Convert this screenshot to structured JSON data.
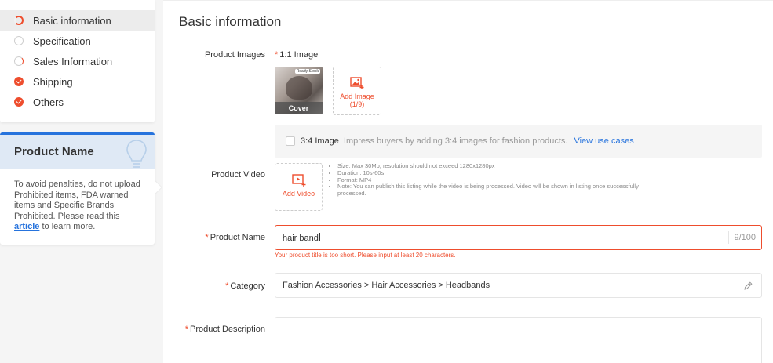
{
  "nav": {
    "items": [
      {
        "label": "Basic information",
        "status": "ring"
      },
      {
        "label": "Specification",
        "status": "empty"
      },
      {
        "label": "Sales Information",
        "status": "half"
      },
      {
        "label": "Shipping",
        "status": "check"
      },
      {
        "label": "Others",
        "status": "check"
      }
    ]
  },
  "tip": {
    "title": "Product Name",
    "text_before": "To avoid penalties, do not upload Prohibited items, FDA warned items and Specific Brands Prohibited. Please read this ",
    "link": "article",
    "text_after": " to learn more."
  },
  "main": {
    "section_title": "Basic information",
    "product_images": {
      "label": "Product Images",
      "ratio_label": "1:1 Image",
      "cover_badge": "Ready Stock",
      "cover_label": "Cover",
      "add_label": "Add Image",
      "add_count": "(1/9)"
    },
    "ratio34": {
      "label": "3:4 Image",
      "hint": "Impress buyers by adding 3:4 images for fashion products.",
      "link": "View use cases"
    },
    "product_video": {
      "label": "Product Video",
      "add_label": "Add Video",
      "notes": [
        "Size: Max 30Mb, resolution should not exceed 1280x1280px",
        "Duration: 10s-60s",
        "Format: MP4",
        "Note: You can publish this listing while the video is being processed. Video will be shown in listing once successfully processed."
      ]
    },
    "product_name": {
      "label": "Product Name",
      "value": "hair band",
      "count": "9/100",
      "error": "Your product title is too short. Please input at least 20 characters."
    },
    "category": {
      "label": "Category",
      "value": "Fashion Accessories > Hair Accessories > Headbands"
    },
    "product_description": {
      "label": "Product Description"
    }
  },
  "colors": {
    "accent": "#ee4d2d",
    "link": "#2673dd",
    "tip_header_bg": "#dfe9f5"
  }
}
